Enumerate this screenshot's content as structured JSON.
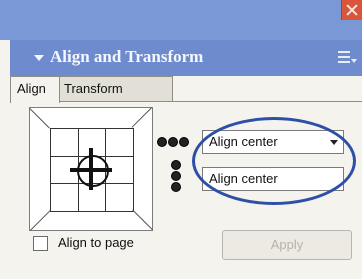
{
  "window": {
    "close_icon": "close-icon",
    "accent_color": "#d8563a"
  },
  "panel": {
    "title": "Align and Transform",
    "header_color": "#6e8ccd",
    "collapse_icon": "triangle-down-icon",
    "menu_icon": "panel-menu-icon"
  },
  "tabs": [
    {
      "label": "Align",
      "active": true
    },
    {
      "label": "Transform",
      "active": false
    }
  ],
  "align": {
    "horizontal": {
      "selected": "Align center",
      "icon": "horizontal-align-icon"
    },
    "vertical": {
      "selected": "Align center",
      "icon": "vertical-align-icon"
    },
    "highlight_color": "#2d4fa6"
  },
  "options": {
    "align_to_page_label": "Align to page",
    "align_to_page_checked": false
  },
  "actions": {
    "apply_label": "Apply",
    "apply_enabled": false
  }
}
